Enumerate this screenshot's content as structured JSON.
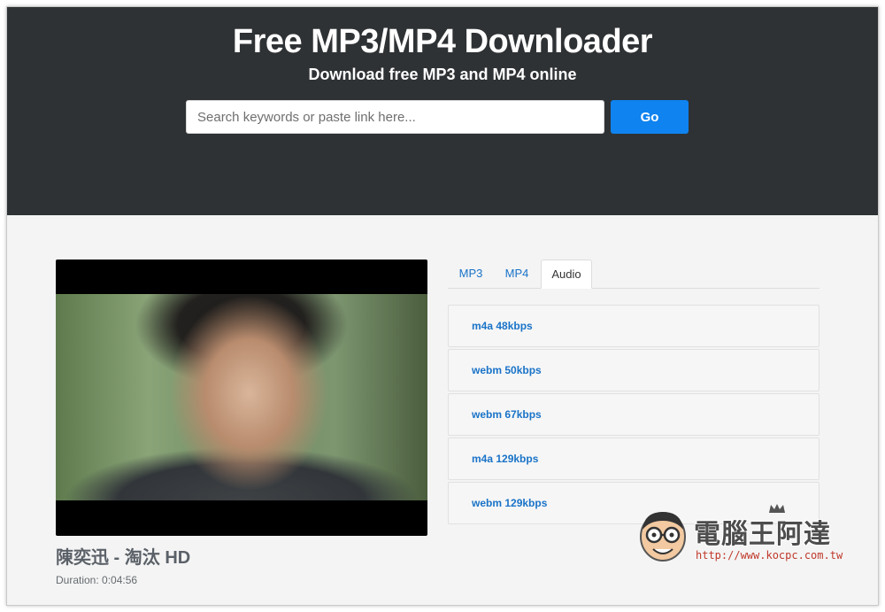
{
  "header": {
    "title": "Free MP3/MP4 Downloader",
    "subtitle": "Download free MP3 and MP4 online"
  },
  "search": {
    "placeholder": "Search keywords or paste link here...",
    "value": "",
    "go_label": "Go"
  },
  "video": {
    "title": "陳奕迅 - 淘汰 HD",
    "duration": "Duration: 0:04:56"
  },
  "tabs": [
    {
      "label": "MP3",
      "active": false
    },
    {
      "label": "MP4",
      "active": false
    },
    {
      "label": "Audio",
      "active": true
    }
  ],
  "formats": [
    {
      "label": "m4a 48kbps"
    },
    {
      "label": "webm 50kbps"
    },
    {
      "label": "webm 67kbps"
    },
    {
      "label": "m4a 129kbps"
    },
    {
      "label": "webm 129kbps"
    }
  ],
  "watermark": {
    "text": "電腦王阿達",
    "url": "http://www.kocpc.com.tw"
  },
  "colors": {
    "hero_bg": "#2f3234",
    "accent": "#0f83f0",
    "link": "#1a73c8",
    "page_bg": "#f4f4f4"
  }
}
